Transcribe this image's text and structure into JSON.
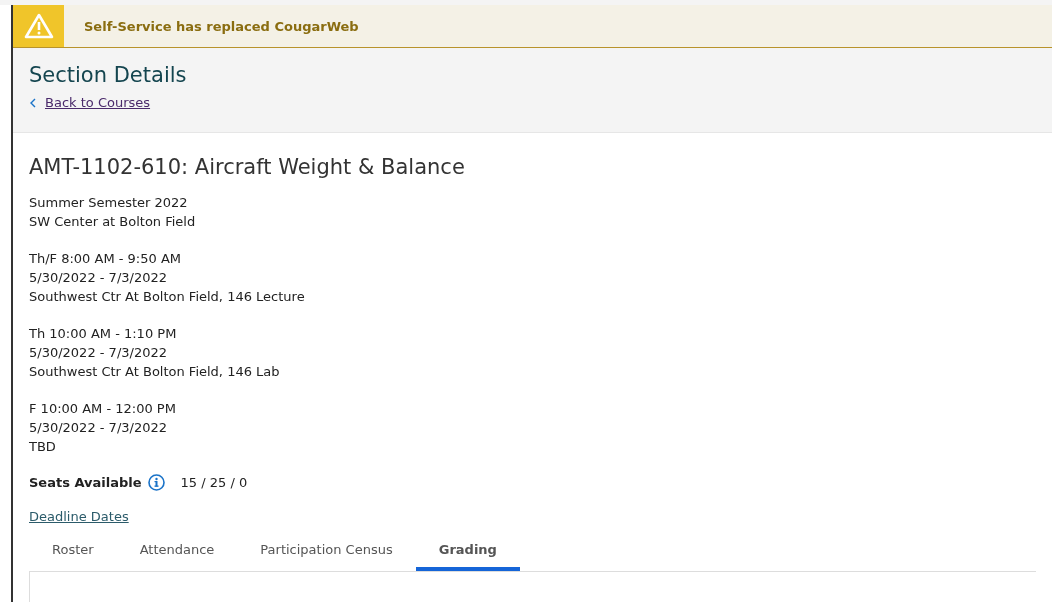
{
  "banner": {
    "message": "Self-Service has replaced CougarWeb"
  },
  "header": {
    "title": "Section Details",
    "back_link": "Back to Courses"
  },
  "section": {
    "title": "AMT-1102-610: Aircraft Weight & Balance",
    "term": "Summer Semester 2022",
    "location": "SW Center at Bolton Field",
    "meetings": [
      {
        "lines": [
          "Th/F 8:00 AM - 9:50 AM",
          "5/30/2022 - 7/3/2022",
          "Southwest Ctr At Bolton Field, 146 Lecture"
        ]
      },
      {
        "lines": [
          "Th 10:00 AM - 1:10 PM",
          "5/30/2022 - 7/3/2022",
          "Southwest Ctr At Bolton Field, 146 Lab"
        ]
      },
      {
        "lines": [
          "F 10:00 AM - 12:00 PM",
          "5/30/2022 - 7/3/2022",
          "TBD"
        ]
      }
    ],
    "seats_label": "Seats Available",
    "seats_value": "15 / 25 / 0",
    "deadline_link": "Deadline Dates"
  },
  "tabs": [
    {
      "label": "Roster",
      "selected": false
    },
    {
      "label": "Attendance",
      "selected": false
    },
    {
      "label": "Participation Census",
      "selected": false
    },
    {
      "label": "Grading",
      "selected": true
    }
  ]
}
